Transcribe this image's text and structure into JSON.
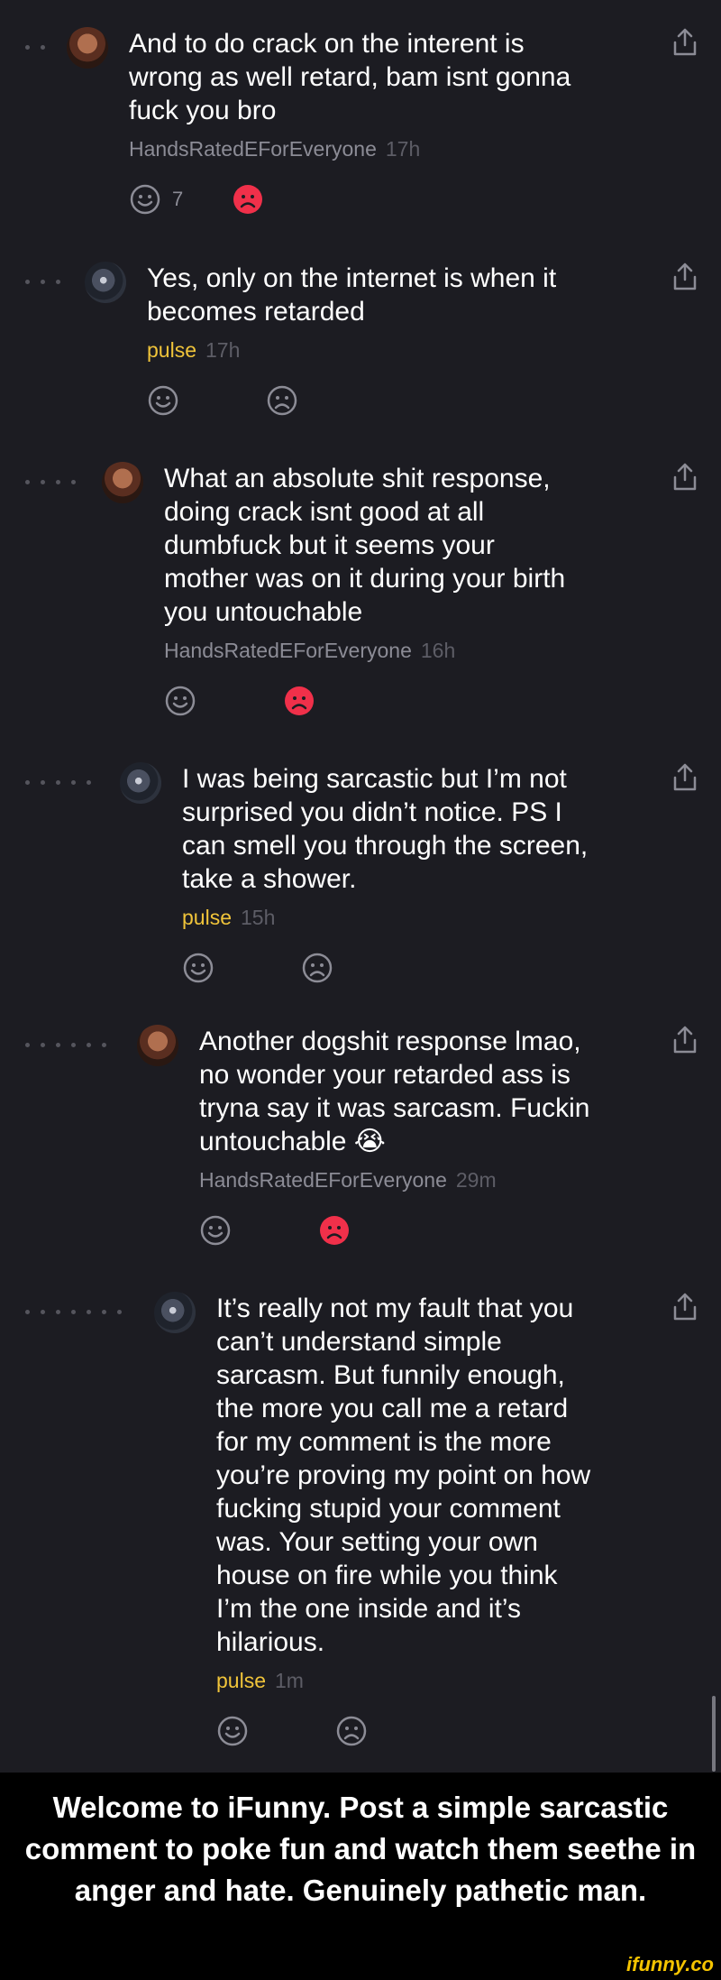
{
  "comments": [
    {
      "text": "And to do crack on the interent is\nwrong as well retard, bam isnt gonna\nfuck you bro",
      "author": "HandsRatedEForEveryone",
      "time": "17h",
      "smile_count": "7"
    },
    {
      "text": "Yes, only on the internet is when it\nbecomes retarded",
      "author": "pulse",
      "time": "17h"
    },
    {
      "text": "What an absolute shit response,\ndoing crack isnt good at all\ndumbfuck but it seems your\nmother was on it during your birth\nyou untouchable",
      "author": "HandsRatedEForEveryone",
      "time": "16h"
    },
    {
      "text": "I was being sarcastic but I’m not\nsurprised you didn’t notice. PS I\ncan smell you through the screen,\ntake a shower.",
      "author": "pulse",
      "time": "15h"
    },
    {
      "text": "Another dogshit response lmao,\nno wonder your retarded ass is\ntryna say it was sarcasm. Fuckin\nuntouchable 😭",
      "author": "HandsRatedEForEveryone",
      "time": "29m"
    },
    {
      "text": "It’s really not my fault that you\ncan’t understand simple\nsarcasm. But funnily enough,\nthe more you call me a retard\nfor my comment is the more\nyou’re proving my point on how\nfucking stupid your comment\nwas. Your setting your own\nhouse on fire while you think\nI’m the one inside and it’s\nhilarious.",
      "author": "pulse",
      "time": "1m"
    }
  ],
  "icons": {
    "smile": "smile-icon",
    "sad": "sad-icon",
    "share": "share-icon"
  },
  "colors": {
    "background": "#1c1c22",
    "author_gray": "#8c8c96",
    "author_yellow": "#f0c43a",
    "sad_active": "#f0304a",
    "caption_bg": "#000000",
    "watermark": "#f5c400"
  },
  "caption": "Welcome to iFunny. Post a simple sarcastic comment to poke fun and watch them seethe in anger and hate. Genuinely pathetic man.",
  "watermark": "ifunny.co"
}
